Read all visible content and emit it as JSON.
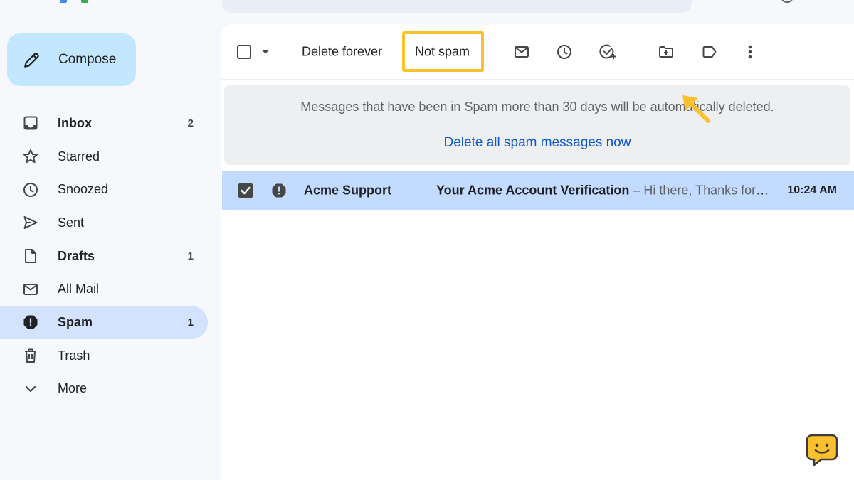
{
  "colors": {
    "accent": "#0b57d0",
    "compose_bg": "#c2e7ff",
    "active_nav_bg": "#d3e3fd",
    "selected_row_bg": "#c2dbff",
    "highlight": "#fbc02d"
  },
  "compose": {
    "label": "Compose",
    "icon": "pencil-icon"
  },
  "sidebar": {
    "items": [
      {
        "label": "Inbox",
        "count": "2",
        "icon": "inbox-icon"
      },
      {
        "label": "Starred",
        "count": "",
        "icon": "star-icon"
      },
      {
        "label": "Snoozed",
        "count": "",
        "icon": "clock-icon"
      },
      {
        "label": "Sent",
        "count": "",
        "icon": "send-icon"
      },
      {
        "label": "Drafts",
        "count": "1",
        "icon": "draft-icon"
      },
      {
        "label": "All Mail",
        "count": "",
        "icon": "mail-icon"
      },
      {
        "label": "Spam",
        "count": "1",
        "icon": "spam-icon",
        "active": true
      },
      {
        "label": "Trash",
        "count": "",
        "icon": "trash-icon"
      },
      {
        "label": "More",
        "count": "",
        "icon": "chevron-down-icon"
      }
    ]
  },
  "toolbar": {
    "delete_forever": "Delete forever",
    "not_spam": "Not spam",
    "icons": [
      "select-all-checkbox",
      "select-dropdown-icon",
      "mark-as-unread-icon",
      "snooze-icon",
      "add-to-tasks-icon",
      "move-to-icon",
      "label-icon",
      "more-options-icon"
    ]
  },
  "banner": {
    "message": "Messages that have been in Spam more than 30 days will be automatically deleted.",
    "link": "Delete all spam messages now"
  },
  "messages": [
    {
      "sender": "Acme Support",
      "subject": "Your Acme Account Verification",
      "separator": " – ",
      "snippet": "Hi there, Thanks for signing up for an Acme account. To complete your registration, please verify your email address.",
      "time": "10:24 AM",
      "selected": true
    }
  ]
}
